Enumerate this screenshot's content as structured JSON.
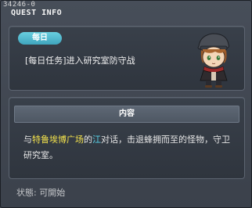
{
  "window": {
    "quest_id": "34246-0",
    "title": "QUEST INFO"
  },
  "quest": {
    "type_badge": "每日",
    "name": "[每日任务]进入研究室防守战"
  },
  "content": {
    "header": "内容",
    "part1": "与",
    "location": "特鲁埃博广场",
    "part2": "的",
    "npc_name": "江",
    "part3": "对话，击退蜂拥而至的怪物，守卫研究室。"
  },
  "status": {
    "label": "状態:",
    "value": "可開始"
  },
  "colors": {
    "highlight_location": "#f2e14c",
    "highlight_npc": "#58d3ea",
    "badge": "#52bcd2"
  }
}
